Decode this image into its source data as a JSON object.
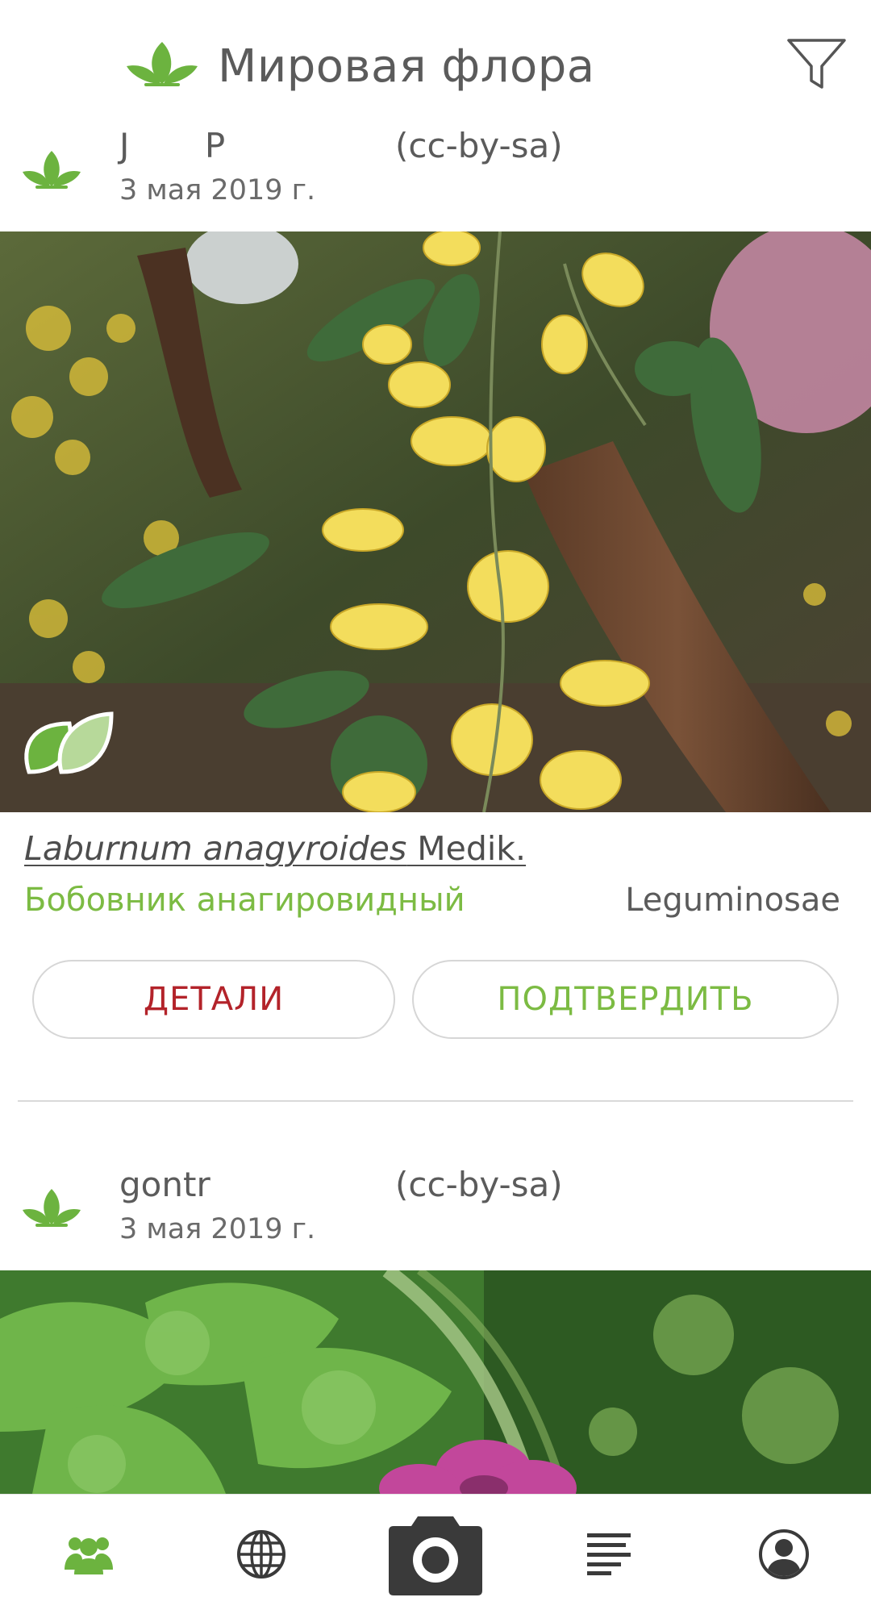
{
  "header": {
    "title": "Мировая флора",
    "logo_icon": "leaves-icon",
    "filter_icon": "filter-icon"
  },
  "posts": [
    {
      "author": "J       P",
      "license": "(cc-by-sa)",
      "date": "3 мая 2019 г.",
      "photo": "yellow-laburnum-flowers",
      "badge_icon": "leaves-badge-icon",
      "species_name": "Laburnum anagyroides",
      "species_author": " Medik.",
      "common_name": "Бобовник анагировидный",
      "family": "Leguminosae",
      "details_label": "ДЕТАЛИ",
      "confirm_label": "ПОДТВЕРДИТЬ"
    },
    {
      "author": "gontr",
      "license": "(cc-by-sa)",
      "date": "3 мая 2019 г.",
      "photo": "pink-geranium-with-green-leaves"
    }
  ],
  "tabbar": {
    "items": [
      {
        "icon": "group-icon",
        "active": true
      },
      {
        "icon": "globe-icon",
        "active": false
      },
      {
        "icon": "camera-icon",
        "active": false
      },
      {
        "icon": "list-icon",
        "active": false
      },
      {
        "icon": "profile-icon",
        "active": false
      }
    ]
  },
  "colors": {
    "accent_green": "#7cbb43",
    "details_red": "#b3232a",
    "text_gray": "#5b5b5b"
  }
}
